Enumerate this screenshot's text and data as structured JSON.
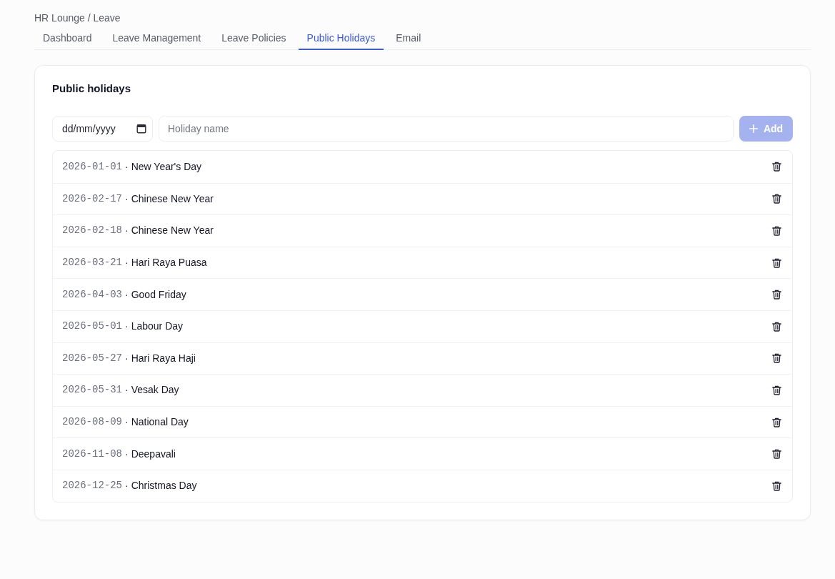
{
  "breadcrumb": "HR Lounge / Leave",
  "tabs": [
    {
      "label": "Dashboard",
      "selected": false
    },
    {
      "label": "Leave Management",
      "selected": false
    },
    {
      "label": "Leave Policies",
      "selected": false
    },
    {
      "label": "Public Holidays",
      "selected": true
    },
    {
      "label": "Email",
      "selected": false
    }
  ],
  "card": {
    "title": "Public holidays",
    "date_field": {
      "placeholder": "dd/mm/yyyy"
    },
    "name_field": {
      "placeholder": "Holiday name"
    },
    "add_button": {
      "label": "Add",
      "disabled": true
    },
    "holidays": [
      {
        "date": "2026-01-01",
        "separator": "·",
        "name": "New Year's Day"
      },
      {
        "date": "2026-02-17",
        "separator": "·",
        "name": "Chinese New Year"
      },
      {
        "date": "2026-02-18",
        "separator": "·",
        "name": "Chinese New Year"
      },
      {
        "date": "2026-03-21",
        "separator": "·",
        "name": "Hari Raya Puasa"
      },
      {
        "date": "2026-04-03",
        "separator": "·",
        "name": "Good Friday"
      },
      {
        "date": "2026-05-01",
        "separator": "·",
        "name": "Labour Day"
      },
      {
        "date": "2026-05-27",
        "separator": "·",
        "name": "Hari Raya Haji"
      },
      {
        "date": "2026-05-31",
        "separator": "·",
        "name": "Vesak Day"
      },
      {
        "date": "2026-08-09",
        "separator": "·",
        "name": "National Day"
      },
      {
        "date": "2026-11-08",
        "separator": "·",
        "name": "Deepavali"
      },
      {
        "date": "2026-12-25",
        "separator": "·",
        "name": "Christmas Day"
      }
    ]
  }
}
